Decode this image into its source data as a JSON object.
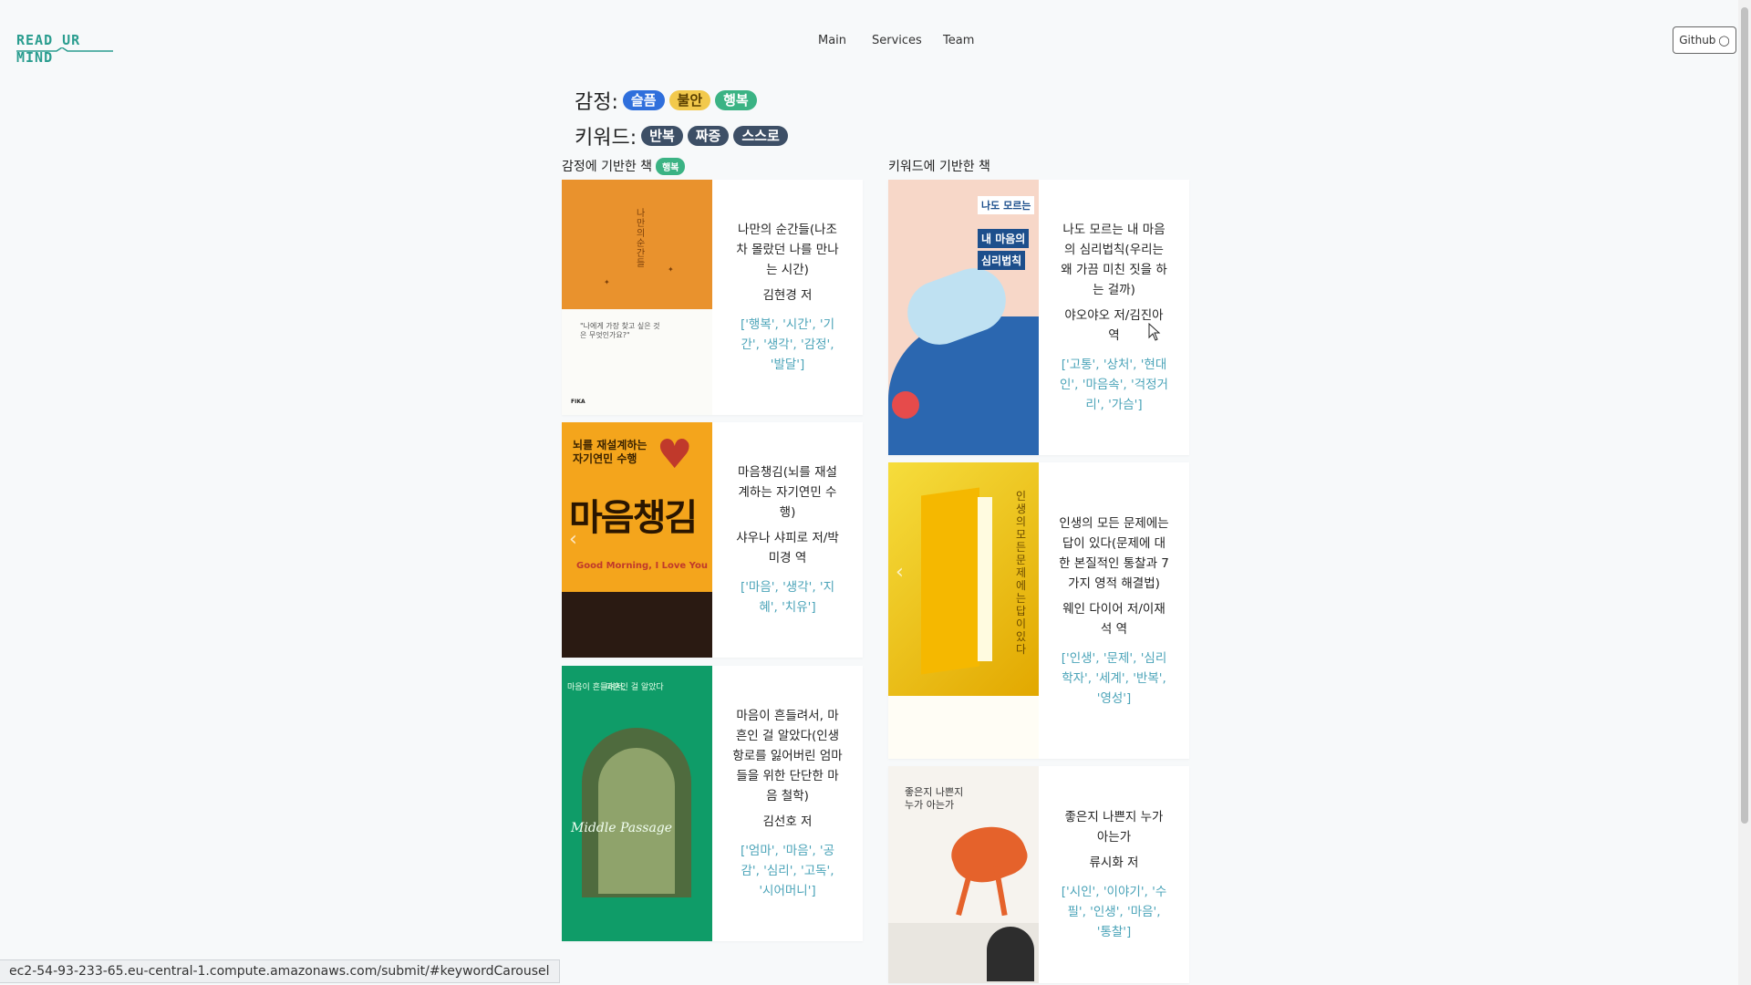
{
  "header": {
    "logo_text": "READ UR MIND",
    "nav": [
      {
        "label": "Main"
      },
      {
        "label": "Services"
      },
      {
        "label": "Team"
      }
    ],
    "github_label": "Github",
    "github_icon": "github-icon"
  },
  "emotion_row": {
    "label": "감정:",
    "tags": [
      "슬픔",
      "불안",
      "행복"
    ]
  },
  "keyword_row": {
    "label": "키워드:",
    "tags": [
      "반복",
      "짜증",
      "스스로"
    ]
  },
  "emotion_section": {
    "title": "감정에 기반한 책",
    "badge": "행복",
    "books": [
      {
        "title": "나만의 순간들(나조차 몰랐던 나를 만나는 시간)",
        "author": "김현경 저",
        "tags": "['행복', '시간', '기간', '생각', '감정', '발달']",
        "cover_text": [
          "나만의 순간들",
          "\"나에게 가장 찾고 싶은 것은 무엇인가요?\"",
          "FIKA"
        ]
      },
      {
        "title": "마음챙김(뇌를 재설계하는 자기연민 수행)",
        "author": "샤우나 샤피로 저/박미경 역",
        "tags": "['마음', '생각', '지혜', '치유']",
        "cover_text": [
          "뇌를 재설계하는 자기연민 수행",
          "마음챙김",
          "Good Morning, I Love You"
        ]
      },
      {
        "title": "마음이 흔들려서, 마흔인 걸 알았다(인생 항로를 잃어버린 엄마들을 위한 단단한 마음 철학)",
        "author": "김선호 저",
        "tags": "['엄마', '마음', '공감', '심리', '고독', '시어머니']",
        "cover_text": [
          "마음이 흔들려서,",
          "마흔인 걸 알았다",
          "Middle Passage"
        ]
      }
    ]
  },
  "keyword_section": {
    "title": "키워드에 기반한 책",
    "books": [
      {
        "title": "나도 모르는 내 마음의 심리법칙(우리는 왜 가끔 미친 짓을 하는 걸까)",
        "author": "야오야오 저/김진아 역",
        "tags": "['고통', '상처', '현대인', '마음속', '걱정거리', '가슴']",
        "cover_text": [
          "나도 모르는",
          "내 마음의",
          "심리법칙"
        ]
      },
      {
        "title": "인생의 모든 문제에는 답이 있다(문제에 대한 본질적인 통찰과 7가지 영적 해결법)",
        "author": "웨인 다이어 저/이재석 역",
        "tags": "['인생', '문제', '심리학자', '세계', '반복', '영성']",
        "cover_text": [
          "인생의 모든 문제에는 답이 있다"
        ]
      },
      {
        "title": "좋은지 나쁜지 누가 아는가",
        "author": "류시화 저",
        "tags": "['시인', '이야기', '수필', '인생', '마음', '통찰']",
        "cover_text": [
          "좋은지 나쁜지",
          "누가 아는가"
        ]
      }
    ]
  },
  "status_bar": {
    "url": "ec2-54-93-233-65.eu-central-1.compute.amazonaws.com/submit/#keywordCarousel"
  },
  "colors": {
    "accent": "#2a9d8f",
    "sad": "#2f6fdc",
    "anxious": "#f2c94c",
    "happy": "#3bb384",
    "keyword": "#3d4f66",
    "tag_text": "#4aa3b8"
  }
}
